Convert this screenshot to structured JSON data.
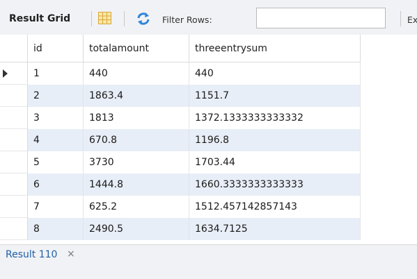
{
  "toolbar": {
    "title": "Result Grid",
    "filter_label": "Filter Rows:",
    "filter_value": "",
    "cutoff_text": "Ex"
  },
  "grid": {
    "columns": [
      "",
      "id",
      "totalamount",
      "threeentrysum"
    ],
    "rows": [
      {
        "id": "1",
        "totalamount": "440",
        "threeentrysum": "440",
        "current": true
      },
      {
        "id": "2",
        "totalamount": "1863.4",
        "threeentrysum": "1151.7"
      },
      {
        "id": "3",
        "totalamount": "1813",
        "threeentrysum": "1372.1333333333332"
      },
      {
        "id": "4",
        "totalamount": "670.8",
        "threeentrysum": "1196.8"
      },
      {
        "id": "5",
        "totalamount": "3730",
        "threeentrysum": "1703.44"
      },
      {
        "id": "6",
        "totalamount": "1444.8",
        "threeentrysum": "1660.3333333333333"
      },
      {
        "id": "7",
        "totalamount": "625.2",
        "threeentrysum": "1512.457142857143"
      },
      {
        "id": "8",
        "totalamount": "2490.5",
        "threeentrysum": "1634.7125"
      }
    ]
  },
  "tabs": [
    {
      "label": "Result 110",
      "close": "×"
    }
  ],
  "colors": {
    "toolbar_bg": "#f1f2f5",
    "alt_row": "#e8eef7",
    "tab_text": "#1f5fa8"
  }
}
